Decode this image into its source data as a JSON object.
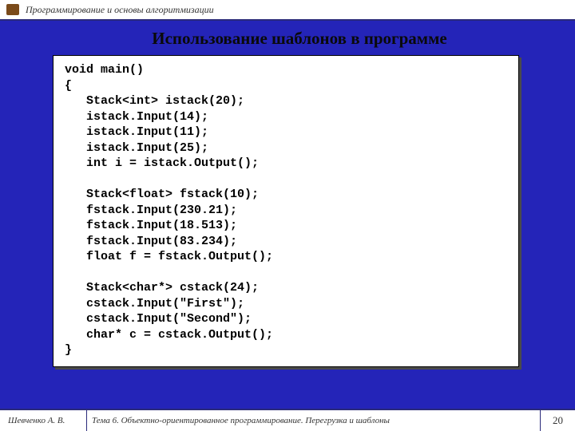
{
  "header": {
    "course_title": "Программирование и основы алгоритмизации"
  },
  "slide": {
    "title": "Использование шаблонов в программе",
    "code": "void main()\n{\n   Stack<int> istack(20);\n   istack.Input(14);\n   istack.Input(11);\n   istack.Input(25);\n   int i = istack.Output();\n\n   Stack<float> fstack(10);\n   fstack.Input(230.21);\n   fstack.Input(18.513);\n   fstack.Input(83.234);\n   float f = fstack.Output();\n\n   Stack<char*> cstack(24);\n   cstack.Input(\"First\");\n   cstack.Input(\"Second\");\n   char* c = cstack.Output();\n}"
  },
  "footer": {
    "author": "Шевченко А. В.",
    "topic": "Тема 6. Объектно-ориентированное программирование. Перегрузка и шаблоны",
    "page": "20"
  }
}
